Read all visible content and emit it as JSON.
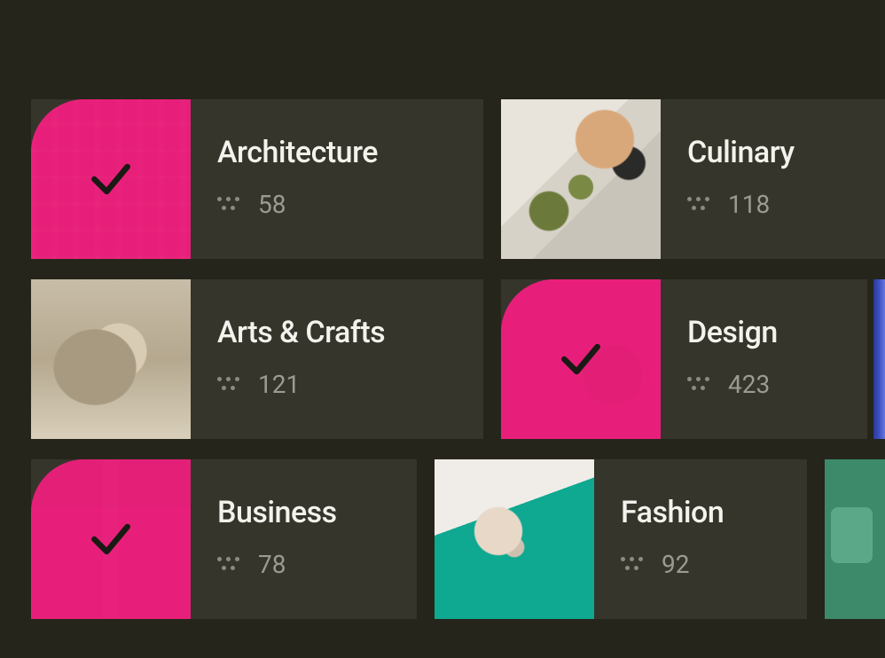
{
  "accent_color": "#e8207a",
  "categories": [
    {
      "id": "architecture",
      "label": "Architecture",
      "count": "58",
      "selected": true
    },
    {
      "id": "culinary",
      "label": "Culinary",
      "count": "118",
      "selected": false
    },
    {
      "id": "arts-crafts",
      "label": "Arts & Crafts",
      "count": "121",
      "selected": false
    },
    {
      "id": "design",
      "label": "Design",
      "count": "423",
      "selected": true
    },
    {
      "id": "business",
      "label": "Business",
      "count": "78",
      "selected": true
    },
    {
      "id": "fashion",
      "label": "Fashion",
      "count": "92",
      "selected": false
    }
  ]
}
